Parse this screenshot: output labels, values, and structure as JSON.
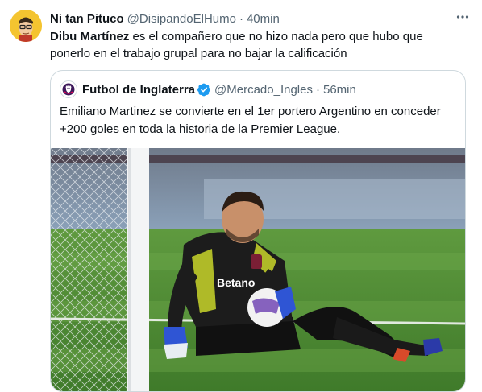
{
  "tweet": {
    "author_name": "Ni tan Pituco",
    "author_handle": "@DisipandoElHumo",
    "separator": "·",
    "time": "40min",
    "text_bold": "Dibu Martínez",
    "text_rest": " es el compañero que no hizo nada pero que hubo que ponerlo en el trabajo grupal  para no bajar la calificación",
    "avatar_icon": "cartoon-face-avatar",
    "more_icon": "more-dots-icon"
  },
  "quote": {
    "author_name": "Futbol de Inglaterra",
    "author_handle": "@Mercado_Ingles",
    "separator": "·",
    "time": "56min",
    "text": "Emiliano Martinez se convierte en el 1er portero Argentino en conceder +200 goles en toda la historia de la Premier League.",
    "verified_icon": "verified-badge-icon",
    "verified_color": "#1d9bf0",
    "avatar_icon": "premier-league-lion-logo",
    "media": {
      "description": "goalkeeper-photo",
      "shirt_text": "Betano"
    }
  }
}
